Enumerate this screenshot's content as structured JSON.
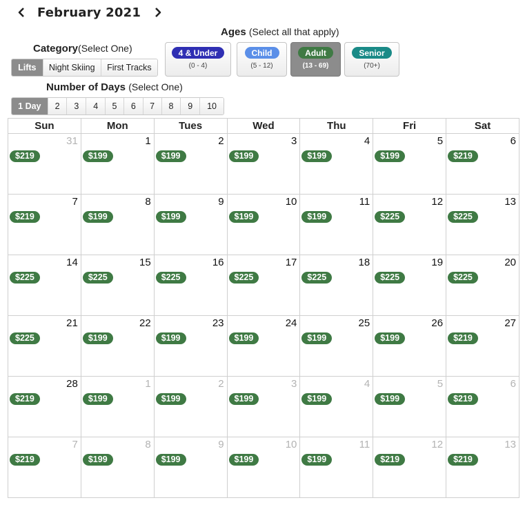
{
  "header": {
    "month_title": "February 2021",
    "prev_icon": "chevron-left-icon",
    "next_icon": "chevron-right-icon"
  },
  "category": {
    "title": "Category",
    "subtitle": "(Select One)",
    "options": [
      "Lifts",
      "Night Skiing",
      "First Tracks"
    ],
    "selected": "Lifts"
  },
  "ages": {
    "title": "Ages",
    "subtitle": "(Select all that apply)",
    "options": [
      {
        "label": "4 & Under",
        "range": "(0 - 4)",
        "color": "#2f2fb3",
        "selected": false
      },
      {
        "label": "Child",
        "range": "(5 - 12)",
        "color": "#5b8fe8",
        "selected": false
      },
      {
        "label": "Adult",
        "range": "(13 - 69)",
        "color": "#3f7a44",
        "selected": true
      },
      {
        "label": "Senior",
        "range": "(70+)",
        "color": "#1a8a87",
        "selected": false
      }
    ]
  },
  "days": {
    "title": "Number of Days",
    "subtitle": "(Select One)",
    "options": [
      "1 Day",
      "2",
      "3",
      "4",
      "5",
      "6",
      "7",
      "8",
      "9",
      "10"
    ],
    "selected": "1 Day"
  },
  "calendar": {
    "weekdays": [
      "Sun",
      "Mon",
      "Tues",
      "Wed",
      "Thu",
      "Fri",
      "Sat"
    ],
    "price_color": "#3f7a44",
    "weeks": [
      [
        {
          "day": "31",
          "price": "$219",
          "other": true
        },
        {
          "day": "1",
          "price": "$199"
        },
        {
          "day": "2",
          "price": "$199"
        },
        {
          "day": "3",
          "price": "$199"
        },
        {
          "day": "4",
          "price": "$199"
        },
        {
          "day": "5",
          "price": "$199"
        },
        {
          "day": "6",
          "price": "$219"
        }
      ],
      [
        {
          "day": "7",
          "price": "$219"
        },
        {
          "day": "8",
          "price": "$199"
        },
        {
          "day": "9",
          "price": "$199"
        },
        {
          "day": "10",
          "price": "$199"
        },
        {
          "day": "11",
          "price": "$199"
        },
        {
          "day": "12",
          "price": "$225"
        },
        {
          "day": "13",
          "price": "$225"
        }
      ],
      [
        {
          "day": "14",
          "price": "$225"
        },
        {
          "day": "15",
          "price": "$225"
        },
        {
          "day": "16",
          "price": "$225"
        },
        {
          "day": "17",
          "price": "$225"
        },
        {
          "day": "18",
          "price": "$225"
        },
        {
          "day": "19",
          "price": "$225"
        },
        {
          "day": "20",
          "price": "$225"
        }
      ],
      [
        {
          "day": "21",
          "price": "$225"
        },
        {
          "day": "22",
          "price": "$199"
        },
        {
          "day": "23",
          "price": "$199"
        },
        {
          "day": "24",
          "price": "$199"
        },
        {
          "day": "25",
          "price": "$199"
        },
        {
          "day": "26",
          "price": "$199"
        },
        {
          "day": "27",
          "price": "$219"
        }
      ],
      [
        {
          "day": "28",
          "price": "$219"
        },
        {
          "day": "1",
          "price": "$199",
          "other": true
        },
        {
          "day": "2",
          "price": "$199",
          "other": true
        },
        {
          "day": "3",
          "price": "$199",
          "other": true
        },
        {
          "day": "4",
          "price": "$199",
          "other": true
        },
        {
          "day": "5",
          "price": "$199",
          "other": true
        },
        {
          "day": "6",
          "price": "$219",
          "other": true
        }
      ],
      [
        {
          "day": "7",
          "price": "$219",
          "other": true
        },
        {
          "day": "8",
          "price": "$199",
          "other": true
        },
        {
          "day": "9",
          "price": "$199",
          "other": true
        },
        {
          "day": "10",
          "price": "$199",
          "other": true
        },
        {
          "day": "11",
          "price": "$199",
          "other": true
        },
        {
          "day": "12",
          "price": "$219",
          "other": true
        },
        {
          "day": "13",
          "price": "$219",
          "other": true
        }
      ]
    ]
  }
}
